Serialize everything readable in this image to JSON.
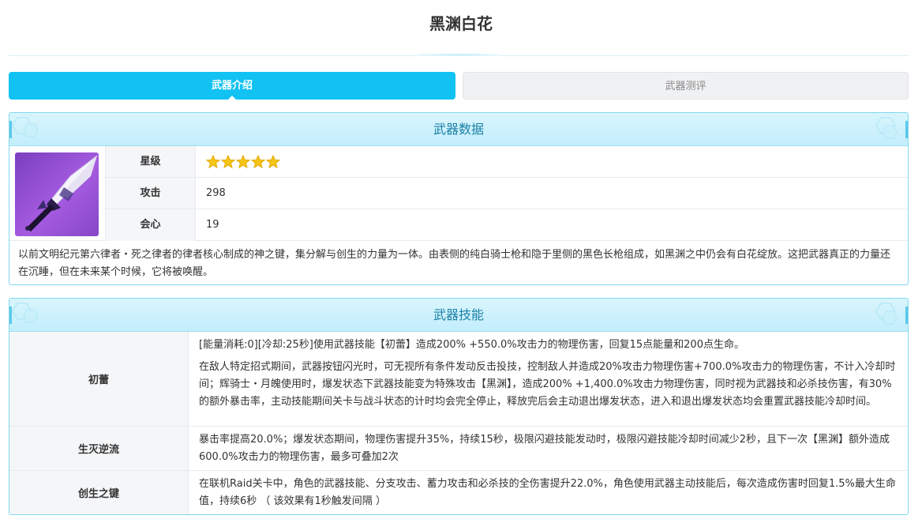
{
  "page": {
    "title": "黑渊白花"
  },
  "tabs": [
    {
      "label": "武器介绍",
      "active": true
    },
    {
      "label": "武器测评",
      "active": false
    }
  ],
  "weapon_data": {
    "heading": "武器数据",
    "stats": {
      "rarity_label": "星级",
      "rarity_stars": 5,
      "attack_label": "攻击",
      "attack_value": "298",
      "crit_label": "会心",
      "crit_value": "19"
    },
    "description": "以前文明纪元第六律者・死之律者的律者核心制成的神之键，集分解与创生的力量为一体。由表侧的纯白骑士枪和隐于里侧的黑色长枪组成，如黑渊之中仍会有白花绽放。这把武器真正的力量还在沉睡，但在未来某个时候，它将被唤醒。"
  },
  "weapon_skills": {
    "heading": "武器技能",
    "skills": [
      {
        "name": "初蕾",
        "paragraphs": [
          "[能量消耗:0][冷却:25秒]使用武器技能【初蕾】造成200% +550.0%攻击力的物理伤害，回复15点能量和200点生命。",
          "在敌人特定招式期间，武器按钮闪光时，可无视所有条件发动反击投技，控制敌人并造成20%攻击力物理伤害+700.0%攻击力的物理伤害，不计入冷却时间；辉骑士・月魄使用时，爆发状态下武器技能变为特殊攻击【黑渊】，造成200% +1,400.0%攻击力物理伤害，同时视为武器技和必杀技伤害，有30%的额外暴击率，主动技能期间关卡与战斗状态的计时均会完全停止，释放完后会主动退出爆发状态，进入和退出爆发状态均会重置武器技能冷却时间。"
        ]
      },
      {
        "name": "生灭逆流",
        "paragraphs": [
          "暴击率提高20.0%；爆发状态期间，物理伤害提升35%，持续15秒，极限闪避技能发动时，极限闪避技能冷却时间减少2秒，且下一次【黑渊】额外造成600.0%攻击力的物理伤害，最多可叠加2次"
        ]
      },
      {
        "name": "创生之键",
        "paragraphs": [
          "在联机Raid关卡中，角色的武器技能、分支攻击、蓄力攻击和必杀技的全伤害提升22.0%，角色使用武器主动技能后，每次造成伤害时回复1.5%最大生命值，持续6秒 （ 该效果有1秒触发间隔 ）"
        ]
      }
    ]
  },
  "colors": {
    "accent": "#11c2f2",
    "panel_border": "#7fd8f0",
    "panel_heading_text": "#1a7fa6",
    "star": "#f5c518"
  },
  "icons": {
    "weapon": "black-abyss-white-flower-lance-icon",
    "star": "star-icon"
  }
}
